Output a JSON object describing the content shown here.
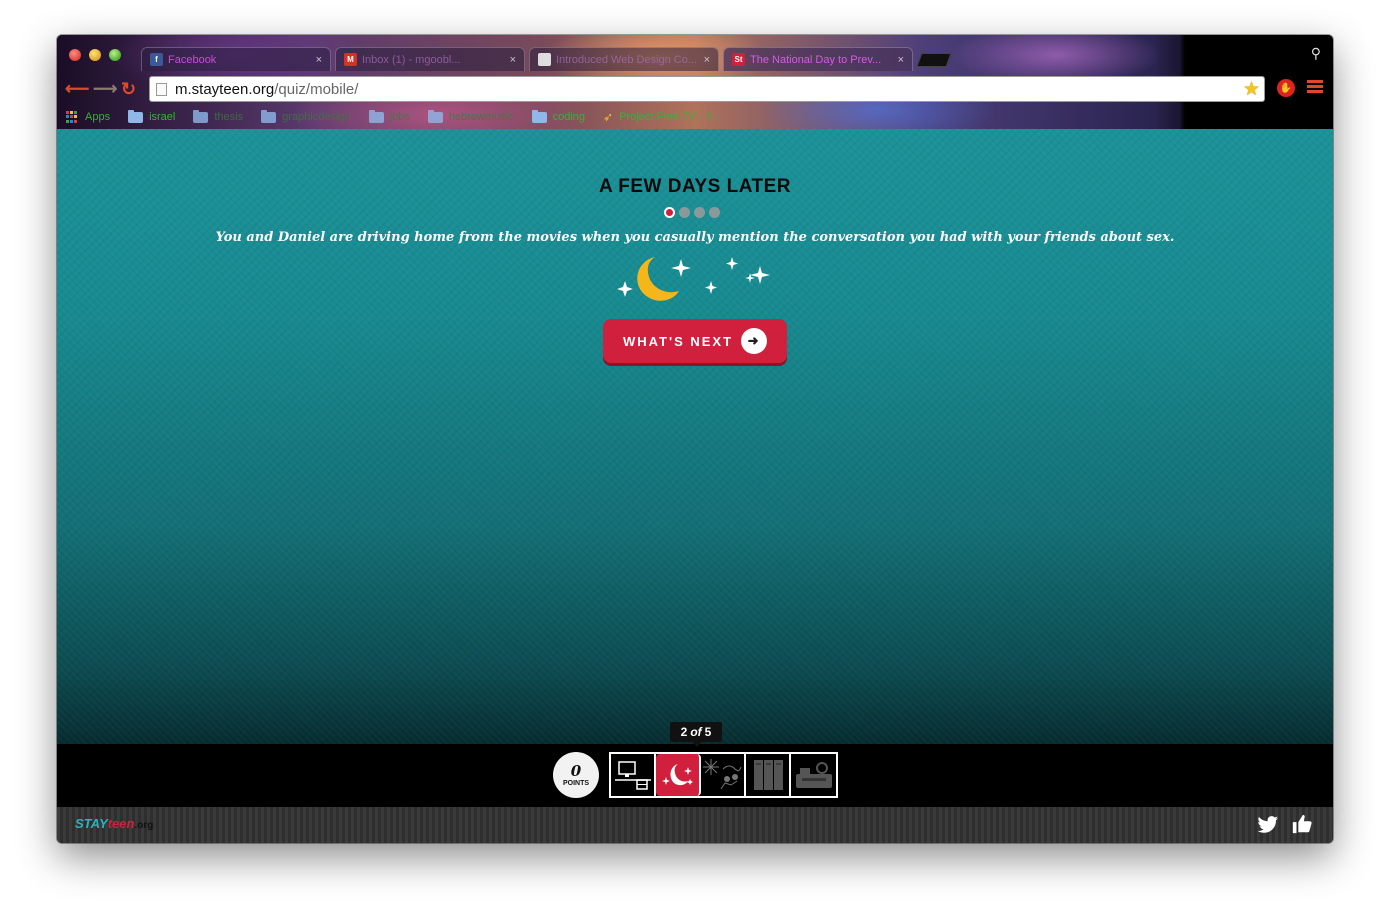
{
  "browser": {
    "tabs": [
      {
        "label": "Facebook",
        "icon": "facebook-favicon",
        "favicon_color": "#3b5998",
        "favicon_glyph": "f"
      },
      {
        "label": "Inbox (1) - mgoobl...",
        "icon": "gmail-favicon",
        "favicon_color": "#d93025",
        "favicon_glyph": "M"
      },
      {
        "label": "Introduced Web Design Co...",
        "icon": "document-favicon",
        "favicon_color": "#cccccc",
        "favicon_glyph": ""
      },
      {
        "label": "The National Day to Prev...",
        "icon": "stayteen-favicon",
        "favicon_color": "#d0203e",
        "favicon_glyph": "St"
      }
    ],
    "tab_close_glyph": "×",
    "url_host": "m.stayteen.org",
    "url_path": "/quiz/mobile/",
    "bookmarks": [
      {
        "label": "Apps",
        "icon": "apps-icon"
      },
      {
        "label": "israel",
        "icon": "folder-icon"
      },
      {
        "label": "thesis",
        "icon": "folder-icon"
      },
      {
        "label": "graphicdesign",
        "icon": "folder-icon"
      },
      {
        "label": "jobs",
        "icon": "folder-icon"
      },
      {
        "label": "hebrewmusic",
        "icon": "folder-icon"
      },
      {
        "label": "coding",
        "icon": "folder-icon"
      },
      {
        "label": "Project Free TV - Y...",
        "icon": "projectfreetv-icon"
      }
    ]
  },
  "quiz": {
    "scene_title": "A FEW DAYS LATER",
    "scene_text": "You and Daniel are driving home from the movies when you casually mention the conversation you had with your friends about sex.",
    "dots_total": 4,
    "dots_active_index": 0,
    "next_button_label": "WHAT'S NEXT",
    "progress": {
      "current": "2",
      "of_word": "of",
      "total": "5"
    },
    "points_value": "0",
    "points_label": "POINTS",
    "steps": [
      {
        "name": "computer",
        "active": false
      },
      {
        "name": "night-moon",
        "active": true
      },
      {
        "name": "party",
        "active": false
      },
      {
        "name": "lockers",
        "active": false
      },
      {
        "name": "car",
        "active": false
      }
    ]
  },
  "footer": {
    "logo_stay": "STAY",
    "logo_teen": "teen",
    "logo_org": ".org"
  },
  "colors": {
    "accent_red": "#d0203e",
    "teal": "#1b9298",
    "moon_yellow": "#f5b619"
  }
}
